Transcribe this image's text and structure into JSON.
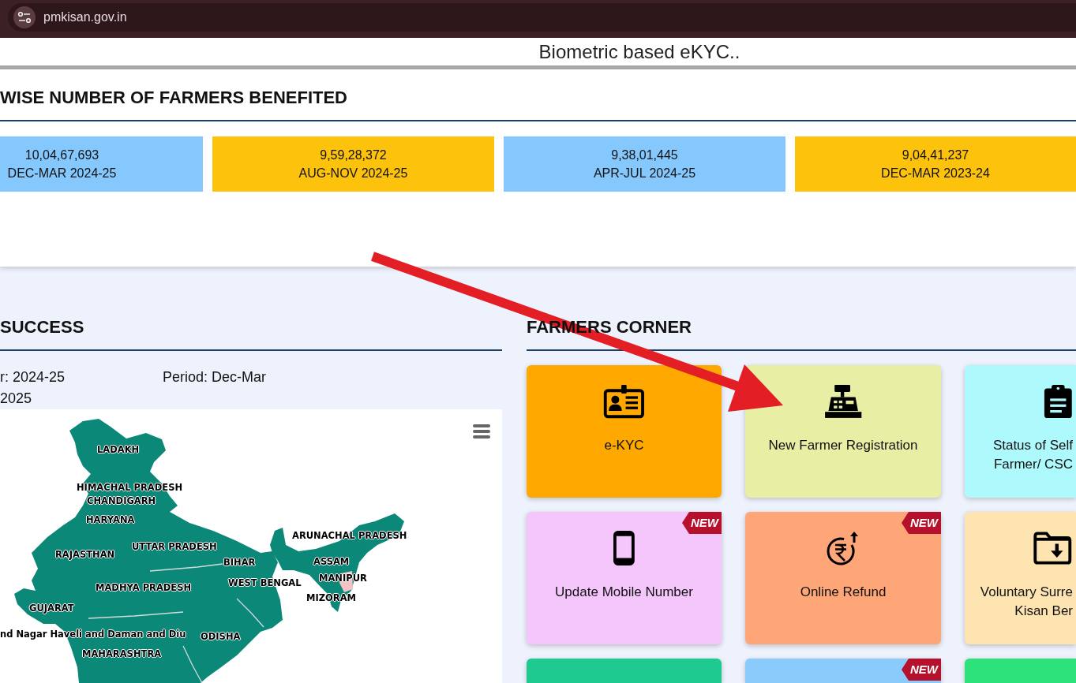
{
  "browser": {
    "url": "pmkisan.gov.in"
  },
  "banner": {
    "text": "Biometric based eKYC.."
  },
  "farmers_benefited": {
    "title": "WISE NUMBER OF FARMERS BENEFITED",
    "stats": [
      {
        "count": "10,04,67,693",
        "period": "DEC-MAR 2024-25",
        "color": "#85c8fd"
      },
      {
        "count": "9,59,28,372",
        "period": "AUG-NOV 2024-25",
        "color": "#fdc20b"
      },
      {
        "count": "9,38,01,445",
        "period": "APR-JUL 2024-25",
        "color": "#85c8fd"
      },
      {
        "count": "9,04,41,237",
        "period": "DEC-MAR 2023-24",
        "color": "#fdc20b"
      }
    ]
  },
  "success": {
    "title": "SUCCESS",
    "info": [
      {
        "lines": [
          "r: 2024-25",
          "2025"
        ]
      },
      {
        "lines": [
          "Period: Dec-Mar"
        ]
      }
    ],
    "map": {
      "labels": [
        "LADAKH",
        "HIMACHAL PRADESH",
        "CHANDIGARH",
        "HARYANA",
        "ARUNACHAL PRADESH",
        "UTTAR PRADESH",
        "RAJASTHAN",
        "BIHAR",
        "ASSAM",
        "MANIPUR",
        "WEST BENGAL",
        "MADHYA PRADESH",
        "MIZORAM",
        "GUJARAT",
        "nd Nagar Haveli and Daman and Diu",
        "ODISHA",
        "MAHARASHTRA"
      ]
    }
  },
  "farmers_corner": {
    "title": "FARMERS CORNER",
    "tiles": [
      {
        "lines": [
          "e-KYC"
        ],
        "color": "#fea800"
      },
      {
        "lines": [
          "New Farmer Registration"
        ],
        "color": "#e8eea3"
      },
      {
        "lines": [
          "Status of Self",
          "Farmer/ CSC"
        ],
        "color": "#adf9fc"
      },
      {
        "lines": [
          "Update Mobile Number"
        ],
        "color": "#f5c6fc",
        "badge": "NEW"
      },
      {
        "lines": [
          "Online Refund"
        ],
        "color": "#fea677",
        "badge": "NEW"
      },
      {
        "lines": [
          "Voluntary Surre",
          "Kisan Ber"
        ],
        "color": "#fde4b1"
      },
      {
        "color": "#1fca91"
      },
      {
        "color": "#8acbfb",
        "badge": "NEW"
      },
      {
        "color": "#2ee27b"
      }
    ]
  }
}
